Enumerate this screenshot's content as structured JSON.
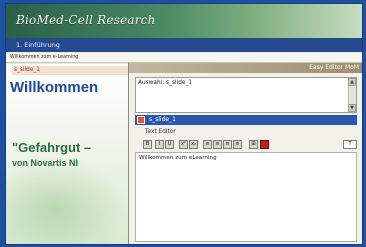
{
  "banner": {
    "title": "BioMed-Cell Research"
  },
  "nav": {
    "current": "1. Einführung"
  },
  "breadcrumb": "Willkommen zum e-Learning",
  "left": {
    "selected_slide": "s_slide_1",
    "welcome": "Willkommen",
    "headline": "\"Gefahrgut –",
    "subline": "von Novartis NI"
  },
  "editor": {
    "window_title": "Easy Editor MoM",
    "selection_text": "Auswahl: s_slide_1",
    "selected_item": "s_slide_1",
    "label": "Text Editor",
    "toolbar": {
      "buttons": [
        "B",
        "I",
        "U",
        "x²",
        "x₂",
        "≡",
        "≡",
        "≡",
        "≡",
        "⊞"
      ],
      "dropdown_value": "T"
    },
    "body_text": "Willkommen zum eLearning"
  },
  "colors": {
    "background": "#1f4fa0",
    "nav": "#24498e",
    "selection": "#2c57b0",
    "headline_green": "#2e6c3a",
    "welcome_blue": "#1e4a99"
  }
}
